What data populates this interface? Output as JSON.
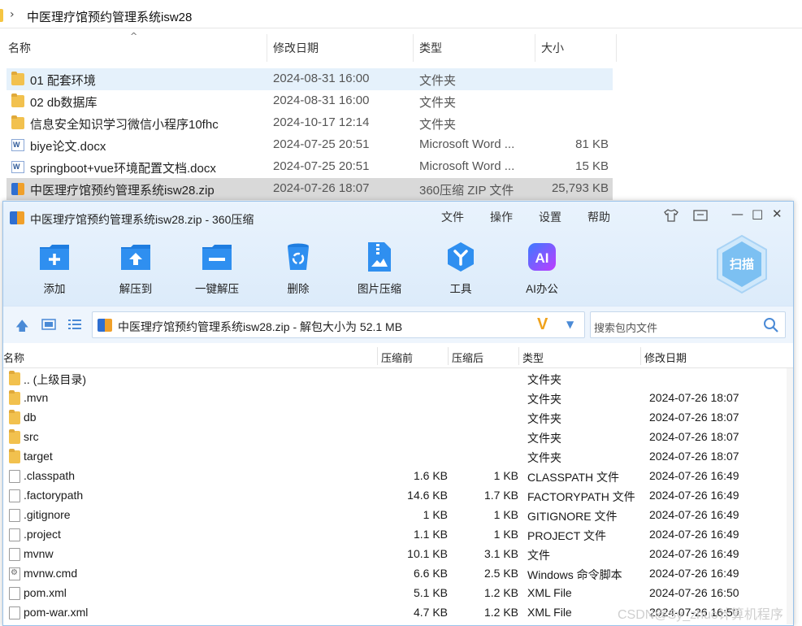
{
  "explorer": {
    "path": "中医理疗馆预约管理系统isw28",
    "columns": {
      "name": "名称",
      "date": "修改日期",
      "type": "类型",
      "size": "大小"
    },
    "rows": [
      {
        "icon": "folder-icon",
        "name": "01 配套环境",
        "date": "2024-08-31 16:00",
        "type": "文件夹",
        "size": ""
      },
      {
        "icon": "folder-icon",
        "name": "02 db数据库",
        "date": "2024-08-31 16:00",
        "type": "文件夹",
        "size": ""
      },
      {
        "icon": "folder-icon",
        "name": "信息安全知识学习微信小程序10fhc",
        "date": "2024-10-17 12:14",
        "type": "文件夹",
        "size": ""
      },
      {
        "icon": "word-doc-icon",
        "name": "biye论文.docx",
        "date": "2024-07-25 20:51",
        "type": "Microsoft Word ...",
        "size": "81 KB"
      },
      {
        "icon": "word-doc-icon",
        "name": "springboot+vue环境配置文档.docx",
        "date": "2024-07-25 20:51",
        "type": "Microsoft Word ...",
        "size": "15 KB"
      },
      {
        "icon": "zip-archive-icon",
        "name": "中医理疗馆预约管理系统isw28.zip",
        "date": "2024-07-26 18:07",
        "type": "360压缩 ZIP 文件",
        "size": "25,793 KB"
      }
    ]
  },
  "zip_window": {
    "title": "中医理疗馆预约管理系统isw28.zip - 360压缩",
    "menu": [
      "文件",
      "操作",
      "设置",
      "帮助"
    ],
    "toolbar": [
      {
        "label": "添加",
        "icon": "add-icon"
      },
      {
        "label": "解压到",
        "icon": "extract-to-icon"
      },
      {
        "label": "一键解压",
        "icon": "one-click-extract-icon"
      },
      {
        "label": "删除",
        "icon": "delete-icon"
      },
      {
        "label": "图片压缩",
        "icon": "image-compress-icon"
      },
      {
        "label": "工具",
        "icon": "tools-icon"
      },
      {
        "label": "AI办公",
        "icon": "ai-office-icon"
      }
    ],
    "scan_label": "扫描",
    "ai_badge": "AI",
    "path_text": "中医理疗馆预约管理系统isw28.zip - 解包大小为 52.1 MB",
    "v_logo": "V",
    "search_placeholder": "搜索包内文件",
    "columns": {
      "name": "名称",
      "before": "压缩前",
      "after": "压缩后",
      "type": "类型",
      "date": "修改日期"
    },
    "files": [
      {
        "icon": "folder-icon",
        "name": ".. (上级目录)",
        "before": "",
        "after": "",
        "type": "文件夹",
        "date": ""
      },
      {
        "icon": "folder-icon",
        "name": ".mvn",
        "before": "",
        "after": "",
        "type": "文件夹",
        "date": "2024-07-26 18:07"
      },
      {
        "icon": "folder-icon",
        "name": "db",
        "before": "",
        "after": "",
        "type": "文件夹",
        "date": "2024-07-26 18:07"
      },
      {
        "icon": "folder-icon",
        "name": "src",
        "before": "",
        "after": "",
        "type": "文件夹",
        "date": "2024-07-26 18:07"
      },
      {
        "icon": "folder-icon",
        "name": "target",
        "before": "",
        "after": "",
        "type": "文件夹",
        "date": "2024-07-26 18:07"
      },
      {
        "icon": "file-icon",
        "name": ".classpath",
        "before": "1.6 KB",
        "after": "1 KB",
        "type": "CLASSPATH 文件",
        "date": "2024-07-26 16:49"
      },
      {
        "icon": "file-icon",
        "name": ".factorypath",
        "before": "14.6 KB",
        "after": "1.7 KB",
        "type": "FACTORYPATH 文件",
        "date": "2024-07-26 16:49"
      },
      {
        "icon": "file-icon",
        "name": ".gitignore",
        "before": "1 KB",
        "after": "1 KB",
        "type": "GITIGNORE 文件",
        "date": "2024-07-26 16:49"
      },
      {
        "icon": "file-icon",
        "name": ".project",
        "before": "1.1 KB",
        "after": "1 KB",
        "type": "PROJECT 文件",
        "date": "2024-07-26 16:49"
      },
      {
        "icon": "file-icon",
        "name": "mvnw",
        "before": "10.1 KB",
        "after": "3.1 KB",
        "type": "文件",
        "date": "2024-07-26 16:49"
      },
      {
        "icon": "cmd-script-icon",
        "name": "mvnw.cmd",
        "before": "6.6 KB",
        "after": "2.5 KB",
        "type": "Windows 命令脚本",
        "date": "2024-07-26 16:49"
      },
      {
        "icon": "file-icon",
        "name": "pom.xml",
        "before": "5.1 KB",
        "after": "1.2 KB",
        "type": "XML File",
        "date": "2024-07-26 16:50"
      },
      {
        "icon": "file-icon",
        "name": "pom-war.xml",
        "before": "4.7 KB",
        "after": "1.2 KB",
        "type": "XML File",
        "date": "2024-07-26 16:50"
      }
    ]
  },
  "watermark": "CSDN@Sy_zhuo计算机程序"
}
